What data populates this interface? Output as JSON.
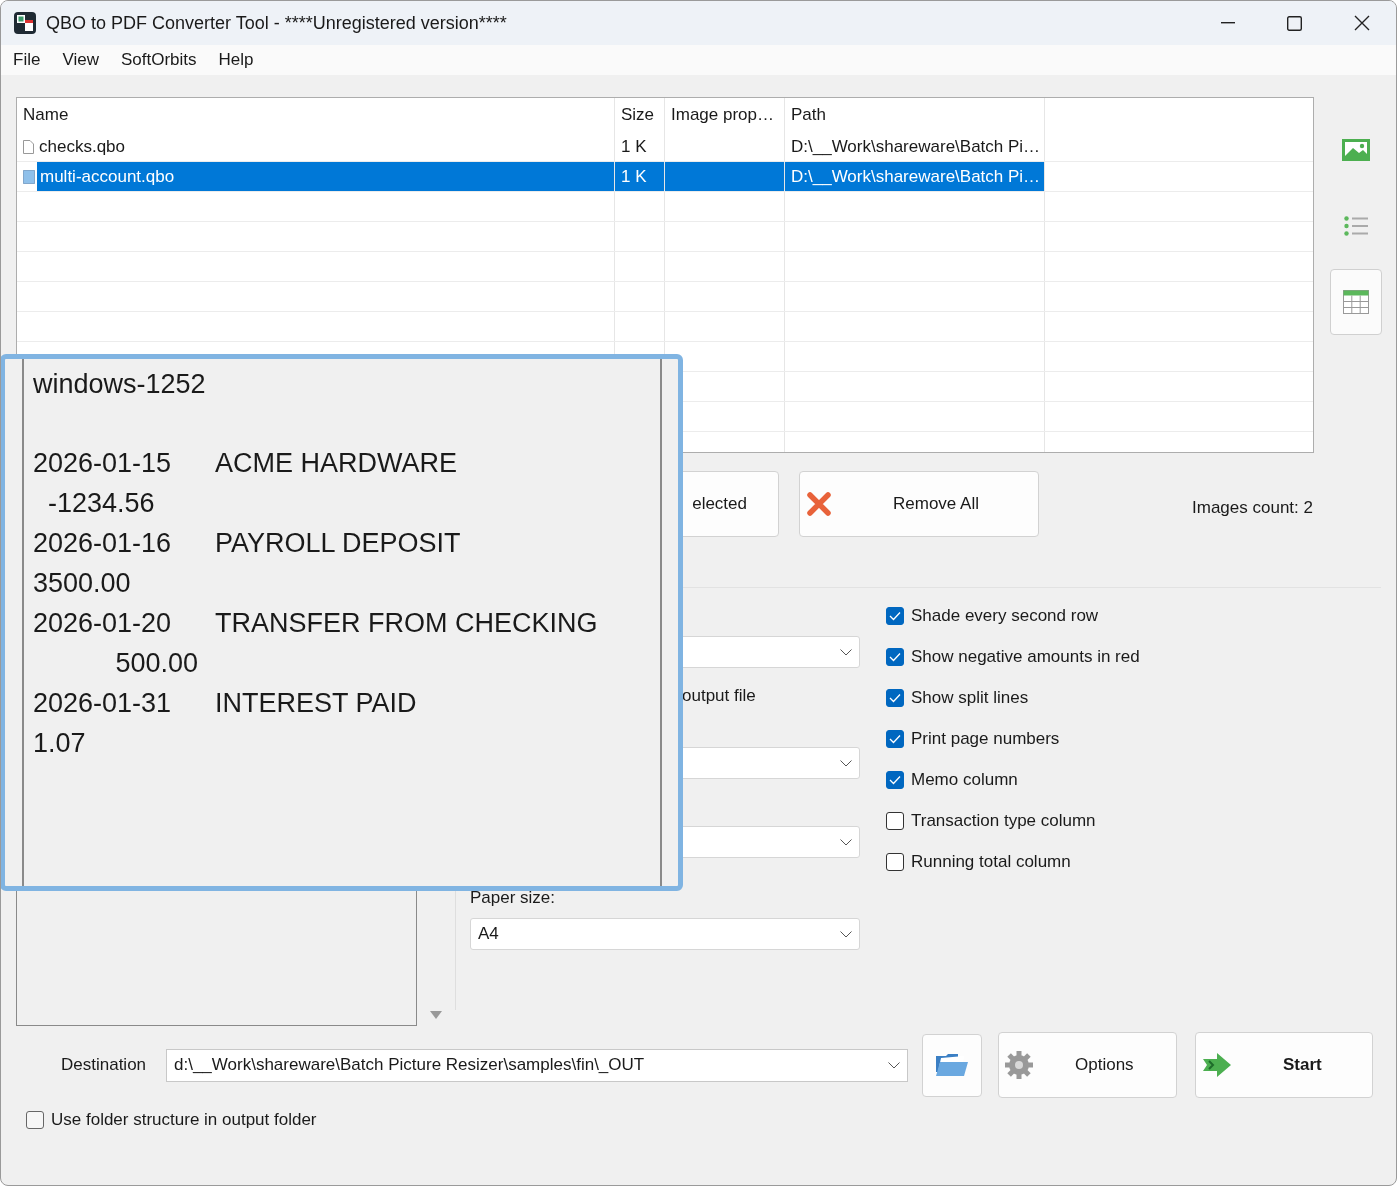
{
  "window": {
    "title": "QBO to PDF Converter Tool - ****Unregistered version****"
  },
  "menu": [
    {
      "label": "File"
    },
    {
      "label": "View"
    },
    {
      "label": "SoftOrbits"
    },
    {
      "label": "Help"
    }
  ],
  "table": {
    "columns": [
      "Name",
      "Size",
      "Image prop…",
      "Path"
    ],
    "rows": [
      {
        "name": "checks.qbo",
        "size": "1 K",
        "path": "D:\\__Work\\shareware\\Batch Pi…",
        "selected": false
      },
      {
        "name": "multi-account.qbo",
        "size": "1 K",
        "path": "D:\\__Work\\shareware\\Batch Pi…",
        "selected": true
      }
    ]
  },
  "view_buttons": [
    {
      "kind": "picture",
      "selected": false
    },
    {
      "kind": "list",
      "selected": false
    },
    {
      "kind": "table",
      "selected": true
    }
  ],
  "remove_selected_button": {
    "label": "elected"
  },
  "remove_all_button": {
    "label": "Remove All"
  },
  "images_count": "Images count: 2",
  "output_file_label": "output file",
  "paper_size": {
    "label": "Paper size:",
    "value": "A4"
  },
  "options": [
    {
      "label": "Shade every second row",
      "checked": true
    },
    {
      "label": "Show negative amounts in red",
      "checked": true
    },
    {
      "label": "Show split lines",
      "checked": true
    },
    {
      "label": "Print page numbers",
      "checked": true
    },
    {
      "label": "Memo column",
      "checked": true
    },
    {
      "label": "Transaction type column",
      "checked": false
    },
    {
      "label": "Running total column",
      "checked": false
    }
  ],
  "destination": {
    "label": "Destination",
    "value": "d:\\__Work\\shareware\\Batch Picture Resizer\\samples\\fin\\_OUT"
  },
  "options_button": "Options",
  "start_button": "Start",
  "use_folder_structure": {
    "label": "Use folder structure in output folder",
    "checked": false
  },
  "preview_popup": {
    "encoding": "windows-1252",
    "transactions": [
      {
        "date": "2026-01-15",
        "payee": "ACME HARDWARE",
        "amount": "  -1234.56"
      },
      {
        "date": "2026-01-16",
        "payee": "PAYROLL DEPOSIT",
        "amount": "3500.00"
      },
      {
        "date": "2026-01-20",
        "payee": "TRANSFER FROM CHECKING",
        "amount": "           500.00"
      },
      {
        "date": "2026-01-31",
        "payee": "INTEREST PAID",
        "amount": "1.07"
      }
    ]
  }
}
